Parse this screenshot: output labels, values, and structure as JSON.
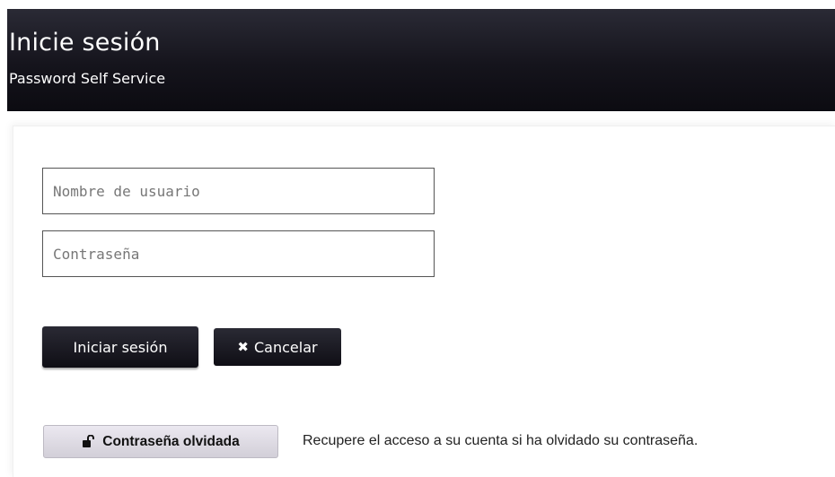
{
  "header": {
    "title": "Inicie sesión",
    "subtitle": "Password Self Service"
  },
  "form": {
    "username": {
      "value": "",
      "placeholder": "Nombre de usuario"
    },
    "password": {
      "value": "",
      "placeholder": "Contraseña"
    },
    "login_label": "Iniciar sesión",
    "cancel_label": "Cancelar",
    "cancel_icon": "x-icon"
  },
  "forgot": {
    "label": "Contraseña olvidada",
    "icon": "unlock-icon",
    "description": "Recupere el acceso a su cuenta si ha olvidado su contraseña."
  },
  "colors": {
    "header_bg": "#15141c",
    "button_bg": "#1a1920",
    "secondary_button_bg": "#dcd9e1"
  }
}
